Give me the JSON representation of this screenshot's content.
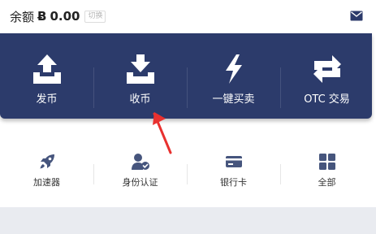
{
  "header": {
    "balance_label": "余额",
    "currency_symbol": "Ƀ",
    "balance_amount": "0.00",
    "switch_label": "切换",
    "mail_icon": "mail-icon"
  },
  "primary_actions": [
    {
      "label": "发币",
      "icon": "upload-tray-icon"
    },
    {
      "label": "收币",
      "icon": "download-tray-icon"
    },
    {
      "label": "一键买卖",
      "icon": "lightning-icon"
    },
    {
      "label": "OTC 交易",
      "icon": "exchange-arrows-icon"
    }
  ],
  "secondary_actions": [
    {
      "label": "加速器",
      "icon": "rocket-icon"
    },
    {
      "label": "身份认证",
      "icon": "user-verified-icon"
    },
    {
      "label": "银行卡",
      "icon": "bank-card-icon"
    },
    {
      "label": "全部",
      "icon": "grid-icon"
    }
  ],
  "colors": {
    "panel_bg": "#2c3b6b",
    "icon_slate": "#46557d",
    "arrow_red": "#e8312f"
  }
}
